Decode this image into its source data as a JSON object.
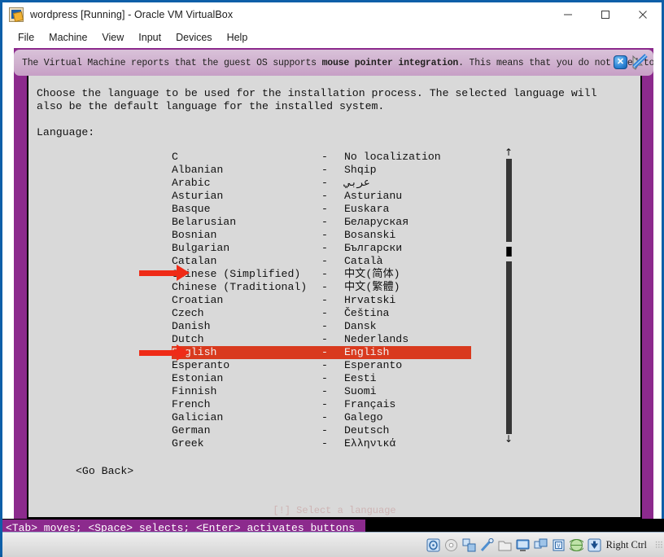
{
  "window": {
    "title": "wordpress [Running] - Oracle VM VirtualBox",
    "icon": "virtualbox-app-icon",
    "controls": [
      {
        "name": "minimize-button",
        "glyph": "minimize-icon"
      },
      {
        "name": "maximize-button",
        "glyph": "maximize-icon"
      },
      {
        "name": "close-button",
        "glyph": "close-icon"
      }
    ]
  },
  "menubar": {
    "items": [
      {
        "label": "File"
      },
      {
        "label": "Machine"
      },
      {
        "label": "View"
      },
      {
        "label": "Input"
      },
      {
        "label": "Devices"
      },
      {
        "label": "Help"
      }
    ]
  },
  "notification": {
    "text_before": "The Virtual Machine reports that the guest OS supports ",
    "text_bold": "mouse pointer integration",
    "text_after": ". This means that you do not need to",
    "close_label": "✕",
    "pointer_icon": "mouse-pointer-integration-icon"
  },
  "console": {
    "hidden_title": "[!] Select a language",
    "intro_line1": "Choose the language to be used for the installation process. The selected language will",
    "intro_line2": "also be the default language for the installed system.",
    "language_label": "Language:",
    "go_back": "<Go Back>",
    "scroll_up": "↑",
    "scroll_down": "↓",
    "highlight_color": "#d93a1e",
    "languages": [
      {
        "name": "C",
        "sep": "-",
        "native": "No localization",
        "selected": false
      },
      {
        "name": "Albanian",
        "sep": "-",
        "native": "Shqip",
        "selected": false
      },
      {
        "name": "Arabic",
        "sep": "-",
        "native": "عربي",
        "selected": false
      },
      {
        "name": "Asturian",
        "sep": "-",
        "native": "Asturianu",
        "selected": false
      },
      {
        "name": "Basque",
        "sep": "-",
        "native": "Euskara",
        "selected": false
      },
      {
        "name": "Belarusian",
        "sep": "-",
        "native": "Беларуская",
        "selected": false
      },
      {
        "name": "Bosnian",
        "sep": "-",
        "native": "Bosanski",
        "selected": false
      },
      {
        "name": "Bulgarian",
        "sep": "-",
        "native": "Български",
        "selected": false
      },
      {
        "name": "Catalan",
        "sep": "-",
        "native": "Català",
        "selected": false
      },
      {
        "name": "Chinese (Simplified)",
        "sep": "-",
        "native": "中文(简体)",
        "selected": false
      },
      {
        "name": "Chinese (Traditional)",
        "sep": "-",
        "native": "中文(繁體)",
        "selected": false
      },
      {
        "name": "Croatian",
        "sep": "-",
        "native": "Hrvatski",
        "selected": false
      },
      {
        "name": "Czech",
        "sep": "-",
        "native": "Čeština",
        "selected": false
      },
      {
        "name": "Danish",
        "sep": "-",
        "native": "Dansk",
        "selected": false
      },
      {
        "name": "Dutch",
        "sep": "-",
        "native": "Nederlands",
        "selected": false
      },
      {
        "name": "English",
        "sep": "-",
        "native": "English",
        "selected": true
      },
      {
        "name": "Esperanto",
        "sep": "-",
        "native": "Esperanto",
        "selected": false
      },
      {
        "name": "Estonian",
        "sep": "-",
        "native": "Eesti",
        "selected": false
      },
      {
        "name": "Finnish",
        "sep": "-",
        "native": "Suomi",
        "selected": false
      },
      {
        "name": "French",
        "sep": "-",
        "native": "Français",
        "selected": false
      },
      {
        "name": "Galician",
        "sep": "-",
        "native": "Galego",
        "selected": false
      },
      {
        "name": "German",
        "sep": "-",
        "native": "Deutsch",
        "selected": false
      },
      {
        "name": "Greek",
        "sep": "-",
        "native": "Ελληνικά",
        "selected": false
      }
    ]
  },
  "console_status": {
    "text": "<Tab> moves; <Space> selects; <Enter> activates buttons"
  },
  "vbox_status": {
    "icons": [
      "hard-disk-icon",
      "optical-disk-icon",
      "floppy-disk-icon",
      "usb-icon",
      "shared-folder-icon",
      "display-icon",
      "network-icon",
      "cpu-icon",
      "globe-icon",
      "capture-icon"
    ],
    "host_key": "Right Ctrl"
  },
  "annotations": [
    {
      "name": "arrow-chinese-simplified",
      "target": "Chinese (Simplified)"
    },
    {
      "name": "arrow-english",
      "target": "English"
    }
  ]
}
